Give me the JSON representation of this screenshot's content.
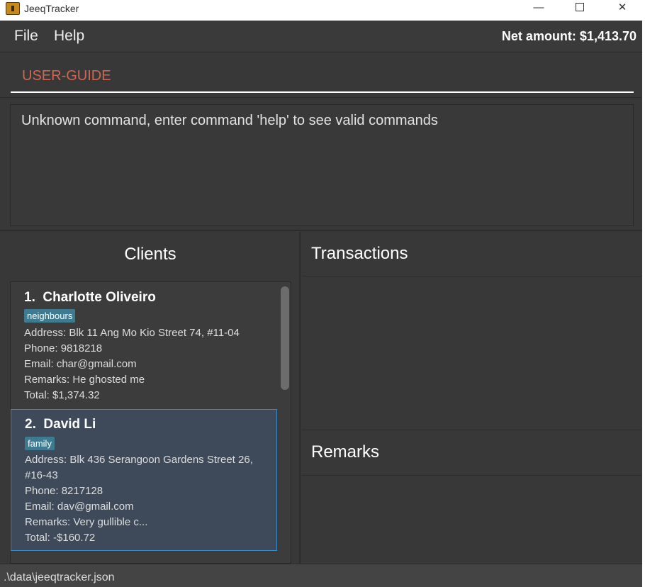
{
  "window": {
    "title": "JeeqTracker",
    "minimize_glyph": "—",
    "close_glyph": "✕"
  },
  "menu": {
    "file": "File",
    "help": "Help",
    "net_amount": "Net amount: $1,413.70"
  },
  "command": {
    "value": "USER-GUIDE",
    "color": "#d06651"
  },
  "result": {
    "text": "Unknown command, enter command 'help' to see valid commands"
  },
  "clients": {
    "title": "Clients",
    "items": [
      {
        "index_name": "1.  Charlotte Oliveiro",
        "tag": "neighbours",
        "address": "Address: Blk 11 Ang Mo Kio Street 74, #11-04",
        "phone": "Phone: 9818218",
        "email": "Email: char@gmail.com",
        "remarks": "Remarks: He ghosted me",
        "total": "Total: $1,374.32"
      },
      {
        "index_name": "2.  David Li",
        "tag": "family",
        "address": "Address: Blk 436 Serangoon Gardens Street 26, #16-43",
        "phone": "Phone: 8217128",
        "email": "Email: dav@gmail.com",
        "remarks": "Remarks: Very gullible c...",
        "total": "Total: -$160.72"
      }
    ]
  },
  "transactions": {
    "title": "Transactions"
  },
  "remarks_panel": {
    "title": "Remarks"
  },
  "status": {
    "path": ".\\data\\jeeqtracker.json"
  },
  "colors": {
    "background": "#383838",
    "selected_card": "#3e4a5a",
    "selected_border": "#3b8ac4",
    "tag": "#3e7b91"
  }
}
